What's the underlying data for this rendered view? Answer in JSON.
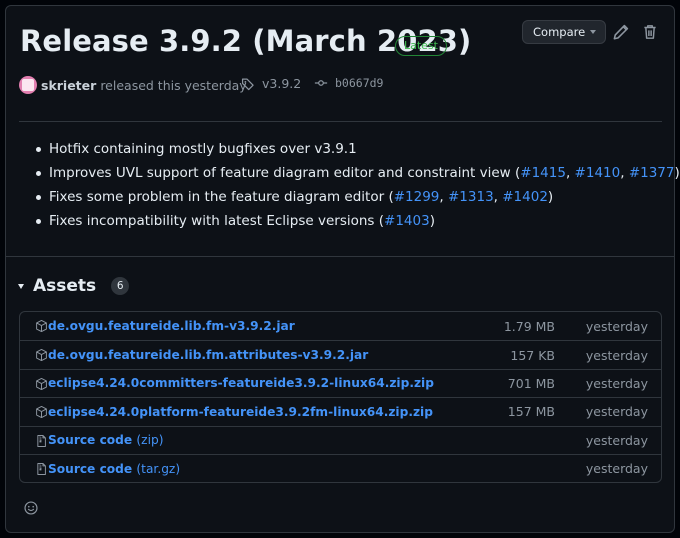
{
  "release": {
    "title": "Release 3.9.2 (March 2023)",
    "latest_badge": "Latest",
    "author": "skrieter",
    "released_text": "released this yesterday",
    "tag": "v3.9.2",
    "commit": "b0667d9"
  },
  "toolbar": {
    "compare_label": "Compare"
  },
  "notes": [
    {
      "text": "Hotfix containing mostly bugfixes over v3.9.1",
      "links": [],
      "suffix": ""
    },
    {
      "text": "Improves UVL support of feature diagram editor and constraint view (",
      "links": [
        "#1415",
        "#1410",
        "#1377"
      ],
      "suffix": ")"
    },
    {
      "text": "Fixes some problem in the feature diagram editor (",
      "links": [
        "#1299",
        "#1313",
        "#1402"
      ],
      "suffix": ")"
    },
    {
      "text": "Fixes incompatibility with latest Eclipse versions (",
      "links": [
        "#1403"
      ],
      "suffix": ")"
    }
  ],
  "assets": {
    "heading": "Assets",
    "count": "6",
    "items": [
      {
        "name": "de.ovgu.featureide.lib.fm-v3.9.2.jar",
        "format": "",
        "size": "1.79 MB",
        "when": "yesterday",
        "icon": "package-icon"
      },
      {
        "name": "de.ovgu.featureide.lib.fm.attributes-v3.9.2.jar",
        "format": "",
        "size": "157 KB",
        "when": "yesterday",
        "icon": "package-icon"
      },
      {
        "name": "eclipse4.24.0committers-featureide3.9.2-linux64.zip.zip",
        "format": "",
        "size": "701 MB",
        "when": "yesterday",
        "icon": "package-icon"
      },
      {
        "name": "eclipse4.24.0platform-featureide3.9.2fm-linux64.zip.zip",
        "format": "",
        "size": "157 MB",
        "when": "yesterday",
        "icon": "package-icon"
      },
      {
        "name": "Source code",
        "format": "(zip)",
        "size": "",
        "when": "yesterday",
        "icon": "file-zip-icon"
      },
      {
        "name": "Source code",
        "format": "(tar.gz)",
        "size": "",
        "when": "yesterday",
        "icon": "file-zip-icon"
      }
    ]
  },
  "colors": {
    "link": "#4493f8",
    "muted": "#8d96a0",
    "latest_green": "#3fb950",
    "border": "#30363d",
    "background": "#0d1117"
  }
}
